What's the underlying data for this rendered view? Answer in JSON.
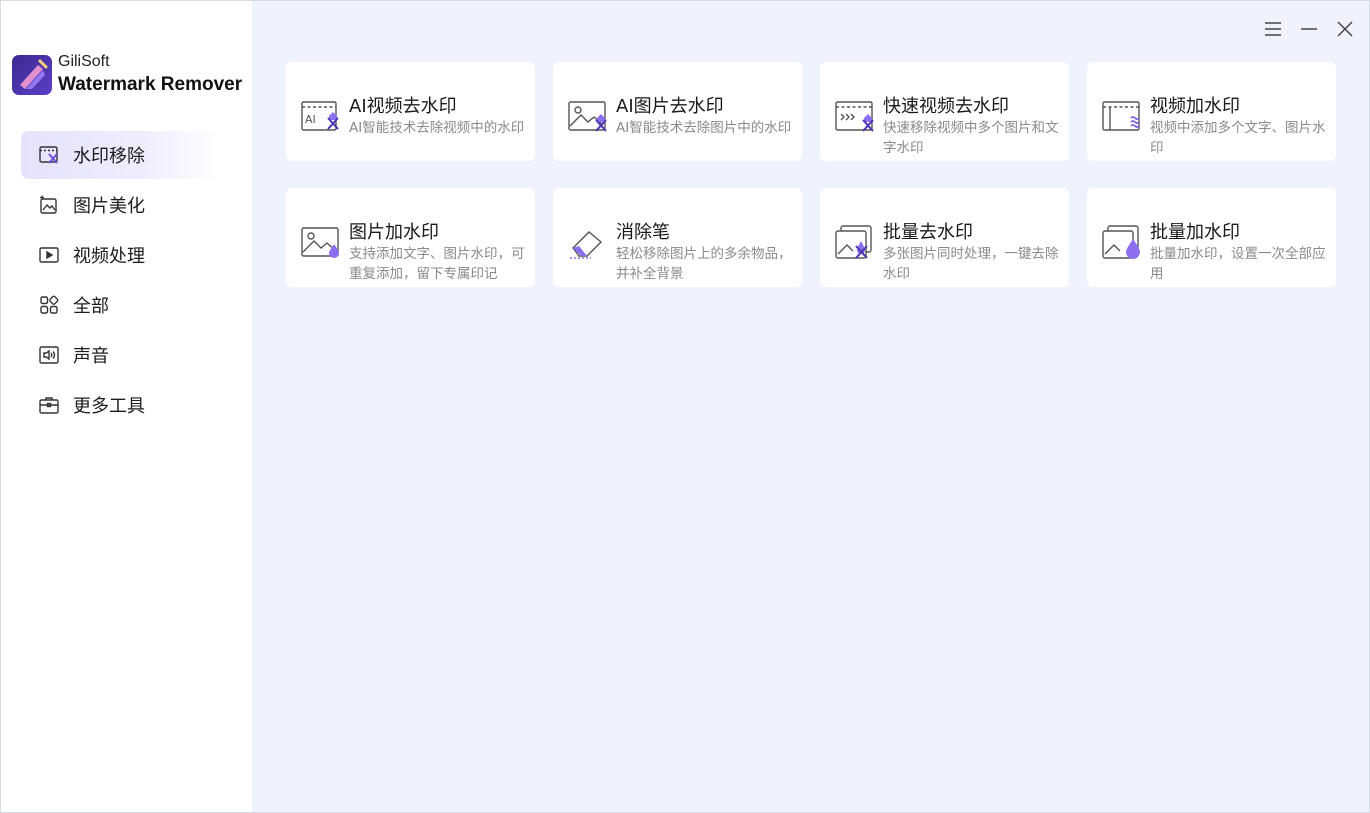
{
  "app": {
    "brand_small": "GiliSoft",
    "brand_big": "Watermark Remover"
  },
  "colors": {
    "accent": "#7b5ce6",
    "background": "#f0f3fd",
    "sidebar_active": "#e7e4fb"
  },
  "window_controls": {
    "menu_icon": "menu-icon",
    "minimize_icon": "minimize-icon",
    "close_icon": "close-icon"
  },
  "sidebar": {
    "items": [
      {
        "label": "水印移除",
        "icon": "video-remove-icon",
        "active": true
      },
      {
        "label": "图片美化",
        "icon": "image-sparkle-icon",
        "active": false
      },
      {
        "label": "视频处理",
        "icon": "video-play-icon",
        "active": false
      },
      {
        "label": "全部",
        "icon": "grid-icon",
        "active": false
      },
      {
        "label": "声音",
        "icon": "speaker-icon",
        "active": false
      },
      {
        "label": "更多工具",
        "icon": "toolbox-icon",
        "active": false
      }
    ]
  },
  "cards": [
    {
      "title": "AI视频去水印",
      "desc": "AI智能技术去除视频中的水印",
      "icon": "ai-video-remove-icon"
    },
    {
      "title": "AI图片去水印",
      "desc": "AI智能技术去除图片中的水印",
      "icon": "ai-image-remove-icon"
    },
    {
      "title": "快速视频去水印",
      "desc": "快速移除视频中多个图片和文字水印",
      "icon": "fast-video-remove-icon"
    },
    {
      "title": "视频加水印",
      "desc": "视频中添加多个文字、图片水印",
      "icon": "video-add-watermark-icon"
    },
    {
      "title": "图片加水印",
      "desc": "支持添加文字、图片水印，可重复添加，留下专属印记",
      "icon": "image-add-watermark-icon"
    },
    {
      "title": "消除笔",
      "desc": "轻松移除图片上的多余物品，并补全背景",
      "icon": "eraser-icon"
    },
    {
      "title": "批量去水印",
      "desc": "多张图片同时处理，一键去除水印",
      "icon": "batch-remove-icon"
    },
    {
      "title": "批量加水印",
      "desc": "批量加水印，设置一次全部应用",
      "icon": "batch-add-icon"
    }
  ]
}
